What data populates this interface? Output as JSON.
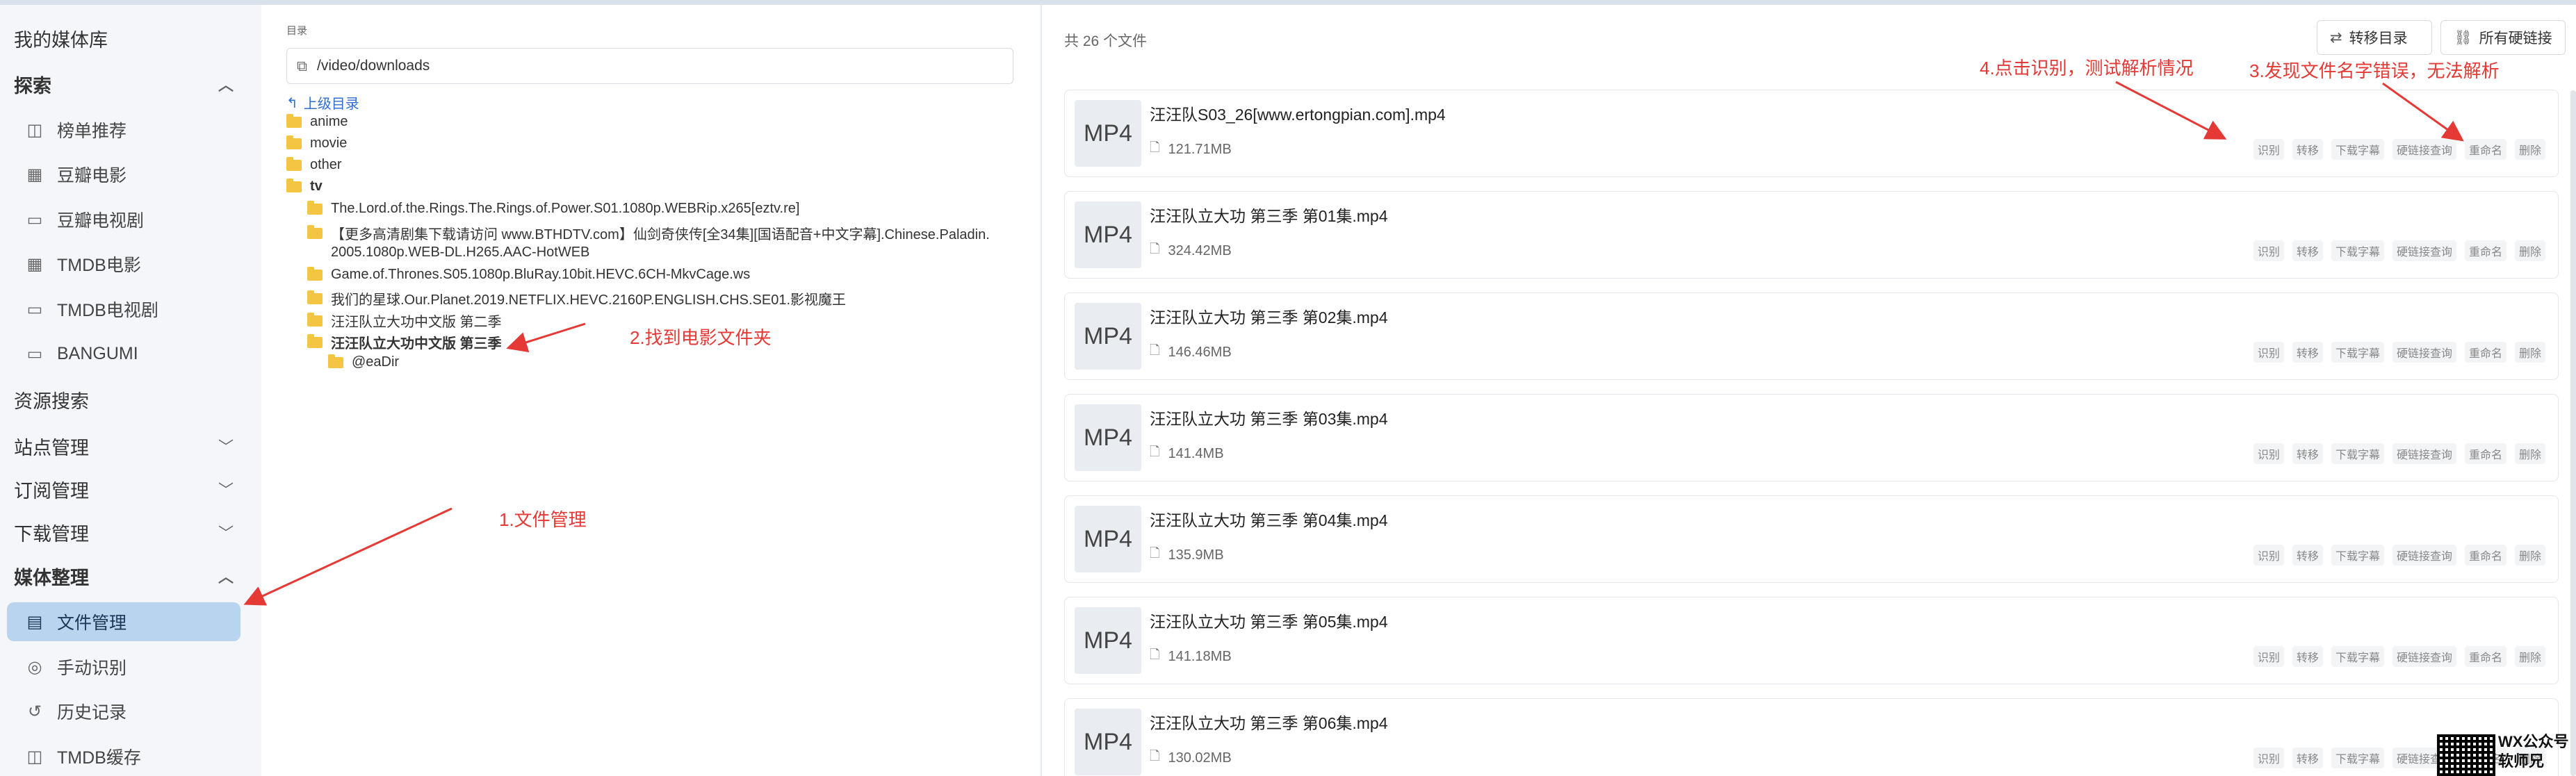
{
  "sidebar": {
    "my_library": "我的媒体库",
    "explore": "探索",
    "explore_items": [
      {
        "label": "榜单推荐",
        "icon": "chart-icon"
      },
      {
        "label": "豆瓣电影",
        "icon": "film-icon"
      },
      {
        "label": "豆瓣电视剧",
        "icon": "tv-icon"
      },
      {
        "label": "TMDB电影",
        "icon": "film-icon"
      },
      {
        "label": "TMDB电视剧",
        "icon": "tv-icon"
      },
      {
        "label": "BANGUMI",
        "icon": "tv-icon"
      }
    ],
    "resource_search": "资源搜索",
    "site_management": "站点管理",
    "subscription_management": "订阅管理",
    "download_management": "下载管理",
    "media_organize": "媒体整理",
    "media_items": [
      {
        "label": "文件管理",
        "icon": "file-icon"
      },
      {
        "label": "手动识别",
        "icon": "scan-icon"
      },
      {
        "label": "历史记录",
        "icon": "history-icon"
      },
      {
        "label": "TMDB缓存",
        "icon": "database-icon"
      }
    ]
  },
  "tree": {
    "dir_label": "目录",
    "path": "/video/downloads",
    "up_label": "上级目录",
    "folders": [
      "anime",
      "movie",
      "other",
      "tv"
    ],
    "tv_children": [
      "The.Lord.of.the.Rings.The.Rings.of.Power.S01.1080p.WEBRip.x265[eztv.re]",
      "【更多高清剧集下载请访问 www.BTHDTV.com】仙剑奇侠传[全34集][国语配音+中文字幕].Chinese.Paladin.",
      "2005.1080p.WEB-DL.H265.AAC-HotWEB",
      "Game.of.Thrones.S05.1080p.BluRay.10bit.HEVC.6CH-MkvCage.ws",
      "我们的星球.Our.Planet.2019.NETFLIX.HEVC.2160P.ENGLISH.CHS.SE01.影视魔王",
      "汪汪队立大功中文版 第二季",
      "汪汪队立大功中文版 第三季"
    ],
    "subfolder": "@eaDir"
  },
  "list": {
    "count_text": "共 26 个文件",
    "transfer_dir_label": "转移目录",
    "hardlinks_label": "所有硬链接",
    "thumb_label": "MP4",
    "actions": [
      "识别",
      "转移",
      "下载字幕",
      "硬链接查询",
      "重命名",
      "删除"
    ],
    "files": [
      {
        "name": "汪汪队S03_26[www.ertongpian.com].mp4",
        "size": "121.71MB"
      },
      {
        "name": "汪汪队立大功 第三季 第01集.mp4",
        "size": "324.42MB"
      },
      {
        "name": "汪汪队立大功 第三季 第02集.mp4",
        "size": "146.46MB"
      },
      {
        "name": "汪汪队立大功 第三季 第03集.mp4",
        "size": "141.4MB"
      },
      {
        "name": "汪汪队立大功 第三季 第04集.mp4",
        "size": "135.9MB"
      },
      {
        "name": "汪汪队立大功 第三季 第05集.mp4",
        "size": "141.18MB"
      },
      {
        "name": "汪汪队立大功 第三季 第06集.mp4",
        "size": "130.02MB"
      }
    ]
  },
  "annotations": {
    "step1": "1.文件管理",
    "step2": "2.找到电影文件夹",
    "step3": "3.发现文件名字错误，无法解析",
    "step4": "4.点击识别，测试解析情况"
  },
  "watermark": {
    "line1": "WX公众号",
    "line2": "软师兄"
  },
  "colors": {
    "accent": "#2f6fd1",
    "annotation": "#e53935",
    "active_nav_bg": "#b8d4ee",
    "folder": "#f4c542"
  }
}
